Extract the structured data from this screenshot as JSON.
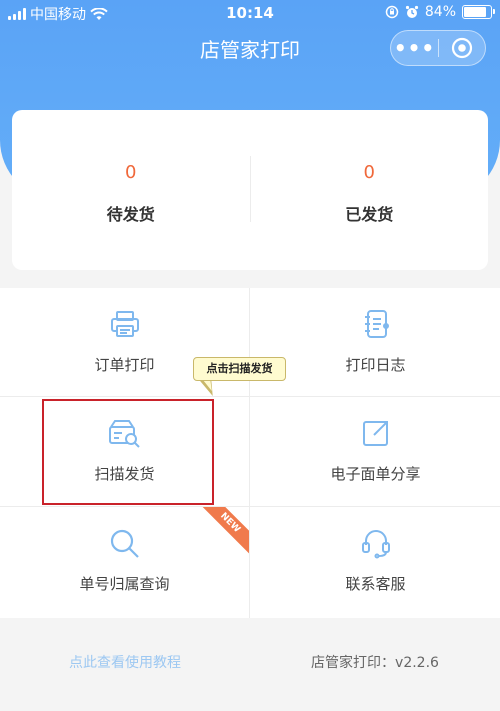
{
  "status_bar": {
    "carrier": "中国移动",
    "time": "10:14",
    "battery": "84%",
    "battery_level": 0.84
  },
  "nav": {
    "title": "店管家打印",
    "more_icon": "more-dots-icon",
    "close_icon": "target-circle-icon"
  },
  "stats": [
    {
      "value": "0",
      "label": "待发货"
    },
    {
      "value": "0",
      "label": "已发货"
    }
  ],
  "menu": [
    {
      "label": "订单打印",
      "icon": "printer-icon"
    },
    {
      "label": "打印日志",
      "icon": "notebook-icon"
    },
    {
      "label": "扫描发货",
      "icon": "scan-truck-icon"
    },
    {
      "label": "电子面单分享",
      "icon": "share-icon"
    },
    {
      "label": "单号归属查询",
      "icon": "search-icon",
      "badge": "NEW"
    },
    {
      "label": "联系客服",
      "icon": "headset-icon"
    }
  ],
  "tooltip": "点击扫描发货",
  "footer": {
    "tutorial_link": "点此查看使用教程",
    "version": "店管家打印：v2.2.6"
  },
  "colors": {
    "brand_blue": "#5aa3f6",
    "stat_orange": "#f0683a",
    "icon_blue": "#7fb8ee",
    "highlight_red": "#c9222a"
  }
}
